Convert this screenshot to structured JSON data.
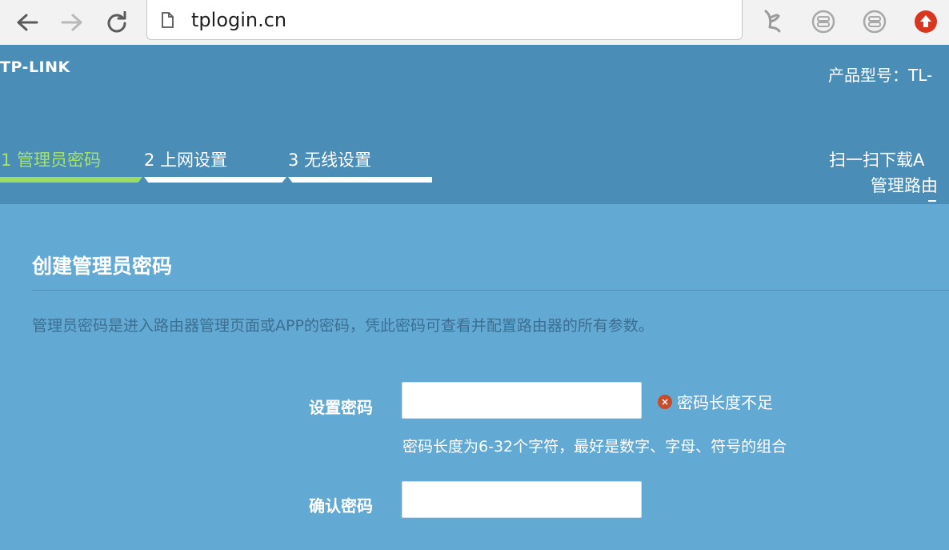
{
  "browser": {
    "url": "tplogin.cn",
    "back_icon": "back-arrow-icon",
    "forward_icon": "forward-arrow-icon",
    "reload_icon": "reload-icon",
    "page_icon": "page-icon",
    "extensions": [
      "extension-icon",
      "extension-icon",
      "extension-icon",
      "opera-extension-icon"
    ]
  },
  "header": {
    "logo": "TP-LINK",
    "model_label": "产品型号：TL-",
    "steps": [
      {
        "label": "1 管理员密码",
        "active": true
      },
      {
        "label": "2 上网设置",
        "active": false
      },
      {
        "label": "3 无线设置",
        "active": false
      }
    ],
    "scan_line1": "扫一扫下载A",
    "scan_line2": "管理路由"
  },
  "form": {
    "title": "创建管理员密码",
    "description": "管理员密码是进入路由器管理页面或APP的密码，凭此密码可查看并配置路由器的所有参数。",
    "password_label": "设置密码",
    "password_value": "",
    "password_error": "密码长度不足",
    "password_hint": "密码长度为6-32个字符，最好是数字、字母、符号的组合",
    "confirm_label": "确认密码",
    "confirm_value": ""
  },
  "colors": {
    "header_bg": "#4a8db7",
    "panel_bg": "#62a9d3",
    "active_step": "#a5e368",
    "error_icon": "#c94c2a"
  }
}
